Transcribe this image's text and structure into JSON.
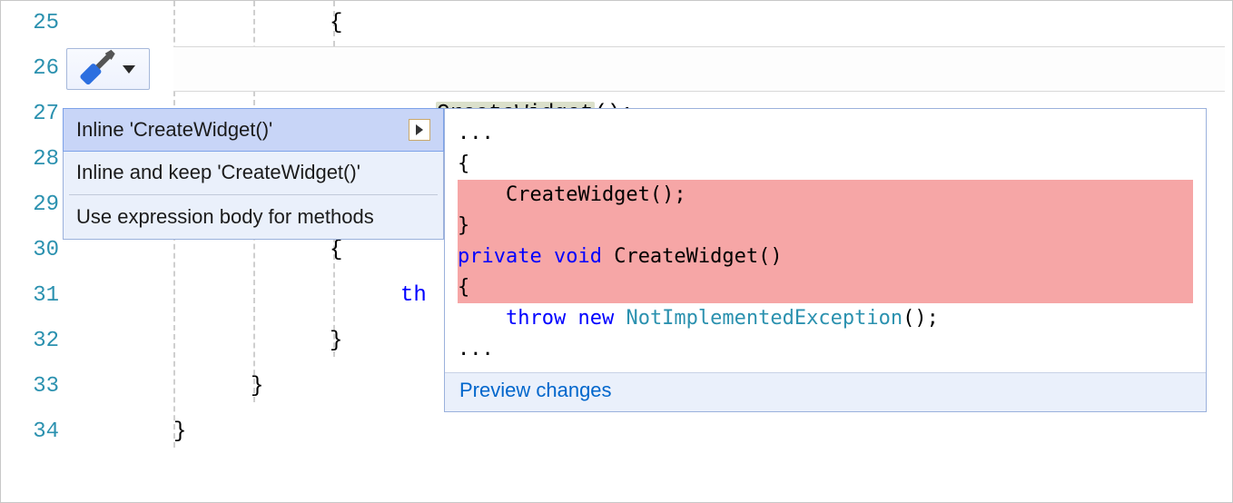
{
  "gutter": {
    "lines": [
      "25",
      "26",
      "27",
      "28",
      "29",
      "30",
      "31",
      "32",
      "33",
      "34"
    ]
  },
  "code": {
    "l25": "{",
    "l26_highlighted": "CreateWidget",
    "l26_rest": "();",
    "l30": "{",
    "l31_kw": "th",
    "l32": "}",
    "l33": "}",
    "l34": "}"
  },
  "quickActions": {
    "items": [
      {
        "label": "Inline 'CreateWidget()'",
        "hasSubmenu": true,
        "selected": true
      },
      {
        "label": "Inline and keep 'CreateWidget()'",
        "hasSubmenu": false,
        "selected": false
      },
      {
        "label": "Use expression body for methods",
        "hasSubmenu": false,
        "selected": false
      }
    ]
  },
  "preview": {
    "lines": {
      "ellipsis": "...",
      "open_brace": "{",
      "call": "    CreateWidget();",
      "close_brace": "}",
      "blank": "",
      "sig_private": "private",
      "sig_void": " void",
      "sig_rest": " CreateWidget()",
      "open_brace2": "{",
      "throw_kw": "    throw",
      "new_kw": " new",
      "exc_type": " NotImplementedException",
      "exc_rest": "();",
      "ellipsis2": "..."
    },
    "footer": "Preview changes"
  }
}
